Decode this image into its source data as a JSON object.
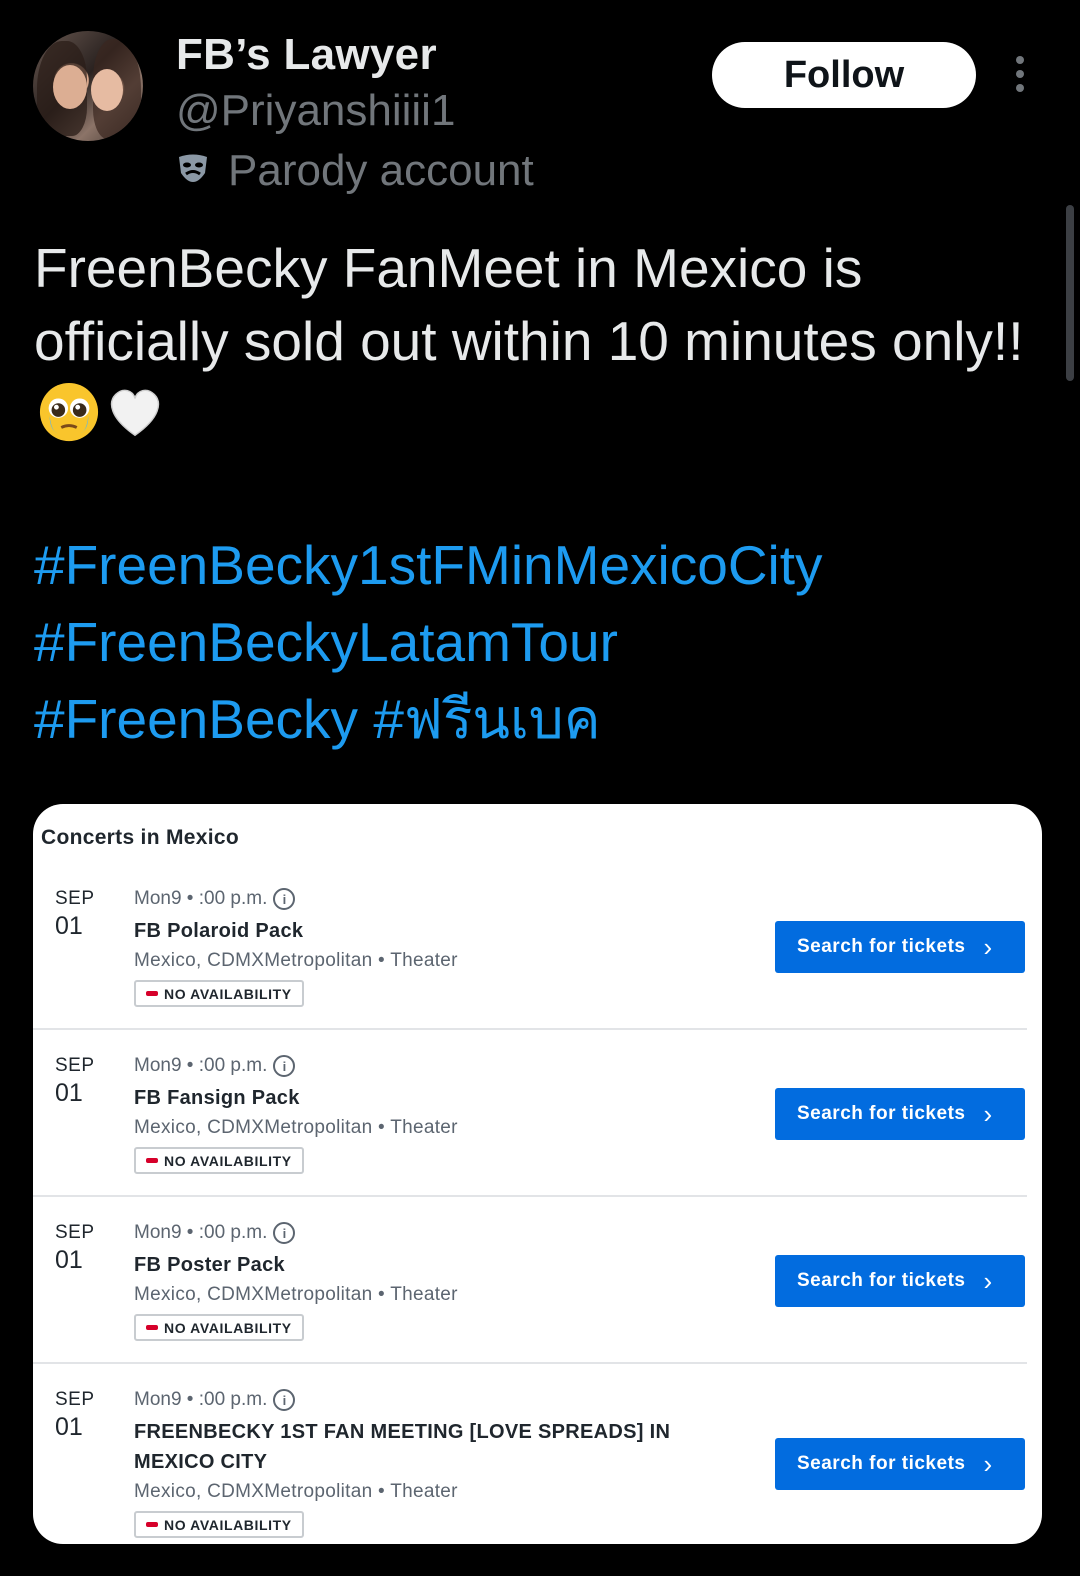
{
  "user": {
    "display_name": "FB’s Lawyer",
    "handle": "@Priyanshiiii1",
    "label": "Parody account",
    "follow_label": "Follow"
  },
  "tweet": {
    "text": "FreenBecky FanMeet in Mexico is officially sold out within 10 minutes only!!",
    "emojis": [
      "pleading-face-with-tears",
      "white-heart"
    ],
    "hashtags": [
      "#FreenBecky1stFMinMexicoCity",
      "#FreenBeckyLatamTour",
      "#FreenBecky",
      "#ฟรีนเบค"
    ]
  },
  "card": {
    "title": "Concerts in Mexico",
    "events": [
      {
        "month": "SEP",
        "day": "01",
        "time": "Mon9 • :00 p.m.",
        "title": "FB Polaroid Pack",
        "venue": "Mexico, CDMXMetropolitan •  Theater",
        "status": "NO AVAILABILITY",
        "button": "Search for tickets"
      },
      {
        "month": "SEP",
        "day": "01",
        "time": "Mon9 • :00 p.m.",
        "title": "FB Fansign Pack",
        "venue": "Mexico, CDMXMetropolitan •  Theater",
        "status": "NO AVAILABILITY",
        "button": "Search for tickets"
      },
      {
        "month": "SEP",
        "day": "01",
        "time": "Mon9 • :00 p.m.",
        "title": "FB Poster Pack",
        "venue": "Mexico, CDMXMetropolitan •  Theater",
        "status": "NO AVAILABILITY",
        "button": "Search for tickets"
      },
      {
        "month": "SEP",
        "day": "01",
        "time": "Mon9 • :00 p.m.",
        "title": "FREENBECKY 1ST FAN MEETING [LOVE SPREADS] IN MEXICO CITY",
        "venue": "Mexico, CDMXMetropolitan •  Theater",
        "status": "NO AVAILABILITY",
        "button": "Search for tickets"
      }
    ]
  },
  "colors": {
    "background": "#000000",
    "hashtag": "#1d9bf0",
    "ticket_button": "#026cdf",
    "unavailable": "#d6002a"
  }
}
